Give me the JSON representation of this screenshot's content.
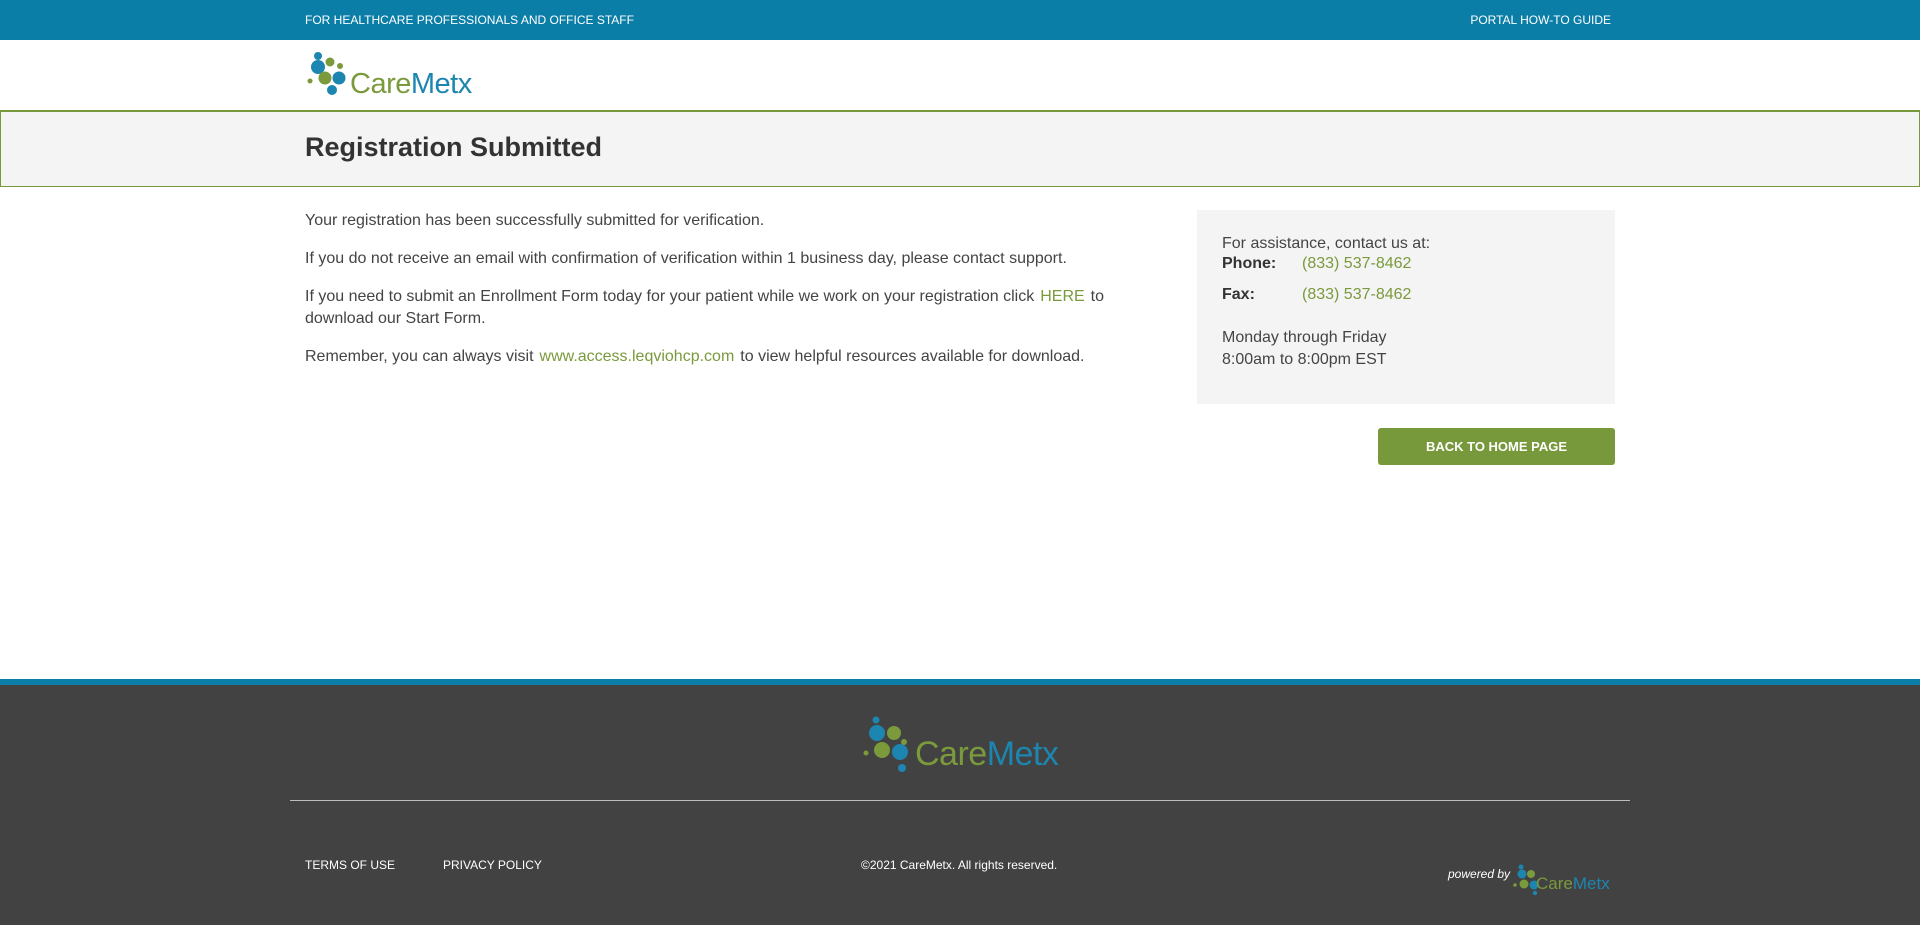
{
  "topbar": {
    "left_text": "FOR HEALTHCARE PROFESSIONALS AND OFFICE STAFF",
    "guide_link": "PORTAL HOW-TO GUIDE"
  },
  "brand": {
    "logo_care": "Care",
    "logo_metx": "Metx",
    "green": "#7a9a3c",
    "blue": "#1c86b0",
    "topbar_color": "#0b7ea8",
    "footer_color": "#424242"
  },
  "page": {
    "title": "Registration Submitted"
  },
  "main": {
    "p1": "Your registration has been successfully submitted for verification.",
    "p2": "If you do not receive an email with confirmation of verification within 1 business day, please contact support.",
    "p3_before": "If you need to submit an Enrollment Form today for your patient while we work on your registration click",
    "p3_link": "HERE",
    "p3_after": "to download our Start Form.",
    "p4_before": "Remember, you can always visit",
    "p4_link": "www.access.leqviohcp.com",
    "p4_after": "to view helpful resources available for download."
  },
  "contact": {
    "intro": "For assistance, contact us at:",
    "phone_label": "Phone:",
    "phone_value": "(833) 537-8462",
    "fax_label": "Fax:",
    "fax_value": "(833) 537-8462",
    "hours_days": "Monday through Friday",
    "hours_time": "8:00am to 8:00pm EST"
  },
  "actions": {
    "home_button": "BACK TO HOME PAGE"
  },
  "footer": {
    "terms": "TERMS OF USE",
    "privacy": "PRIVACY POLICY",
    "copyright": "©2021 CareMetx. All rights reserved.",
    "powered_by": "powered by"
  }
}
